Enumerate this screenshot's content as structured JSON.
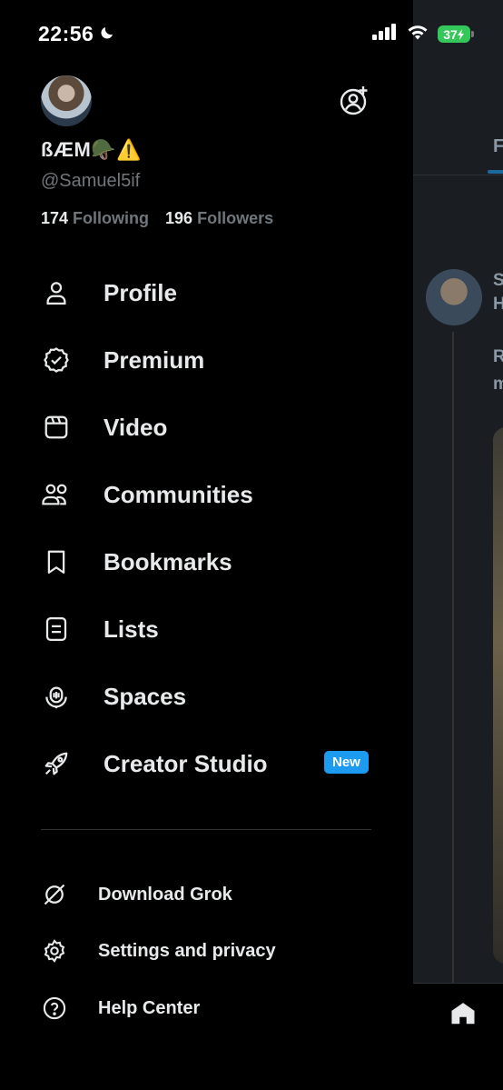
{
  "status_bar": {
    "time": "22:56",
    "battery": "37",
    "colors": {
      "battery": "#34c759"
    }
  },
  "profile": {
    "display_name": "ßÆM🪖⚠️",
    "handle": "@Samuel5if",
    "following_count": "174",
    "following_label": "Following",
    "followers_count": "196",
    "followers_label": "Followers"
  },
  "menu": {
    "items": [
      {
        "label": "Profile",
        "icon": "person-icon"
      },
      {
        "label": "Premium",
        "icon": "verified-badge-icon"
      },
      {
        "label": "Video",
        "icon": "video-icon"
      },
      {
        "label": "Communities",
        "icon": "communities-icon"
      },
      {
        "label": "Bookmarks",
        "icon": "bookmark-icon"
      },
      {
        "label": "Lists",
        "icon": "list-icon"
      },
      {
        "label": "Spaces",
        "icon": "spaces-icon"
      },
      {
        "label": "Creator Studio",
        "icon": "rocket-icon",
        "badge": "New"
      }
    ]
  },
  "secondary": {
    "items": [
      {
        "label": "Download Grok",
        "icon": "grok-icon"
      },
      {
        "label": "Settings and privacy",
        "icon": "gear-icon"
      },
      {
        "label": "Help Center",
        "icon": "help-icon"
      }
    ]
  },
  "background": {
    "tab_text": "F",
    "post_line1": "S",
    "post_line2": "H",
    "post_text1": "R",
    "post_text2": "m"
  },
  "colors": {
    "accent": "#1d9bf0",
    "muted": "#71767b",
    "text": "#e7e9ea"
  }
}
